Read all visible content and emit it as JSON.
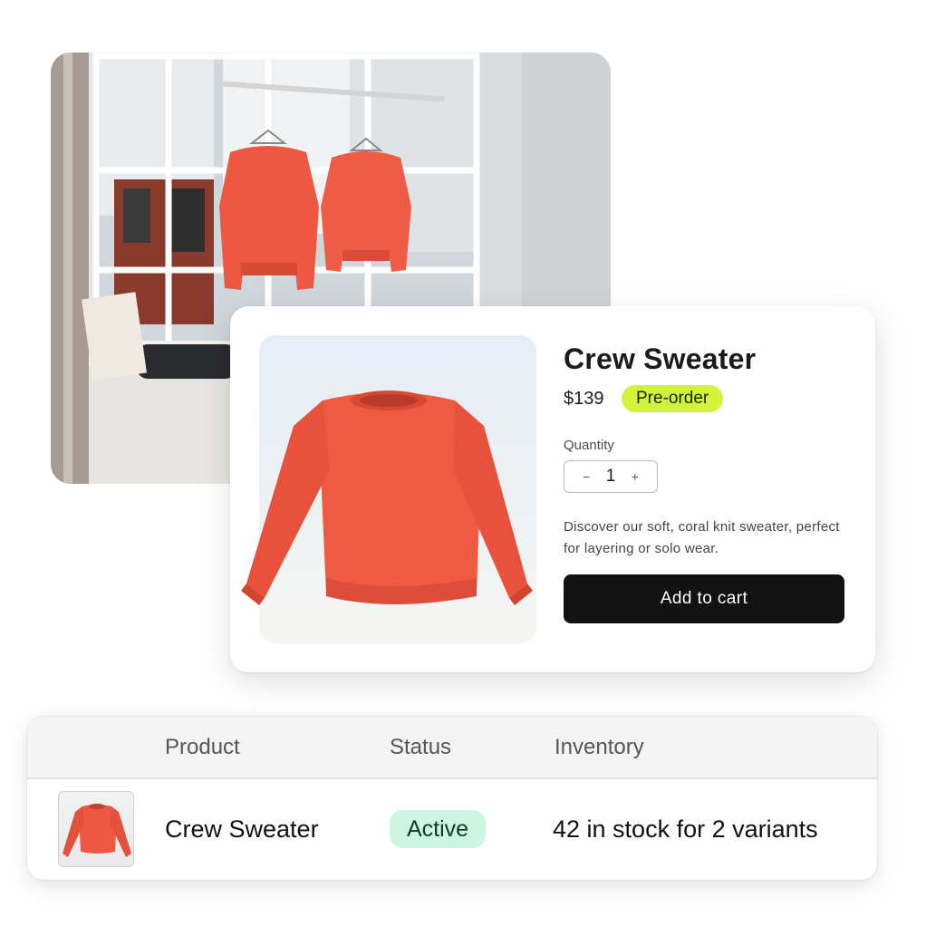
{
  "product_card": {
    "title": "Crew Sweater",
    "price": "$139",
    "badge": "Pre-order",
    "quantity_label": "Quantity",
    "quantity_value": "1",
    "decrement_symbol": "−",
    "increment_symbol": "+",
    "description": "Discover our soft, coral knit sweater, perfect for layering or solo wear.",
    "add_to_cart_label": "Add to cart"
  },
  "table": {
    "headers": [
      "Product",
      "Status",
      "Inventory"
    ],
    "rows": [
      {
        "product": "Crew Sweater",
        "status": "Active",
        "inventory": "42 in stock for 2 variants"
      }
    ]
  },
  "colors": {
    "sweater": "#ef5a43",
    "preorder_badge": "#d2f23b",
    "active_badge": "#cdf6e2",
    "button": "#121212"
  },
  "icons": {
    "store_photo": "store-window-photo",
    "product_image": "sweater-image",
    "thumbnail": "sweater-thumbnail"
  }
}
